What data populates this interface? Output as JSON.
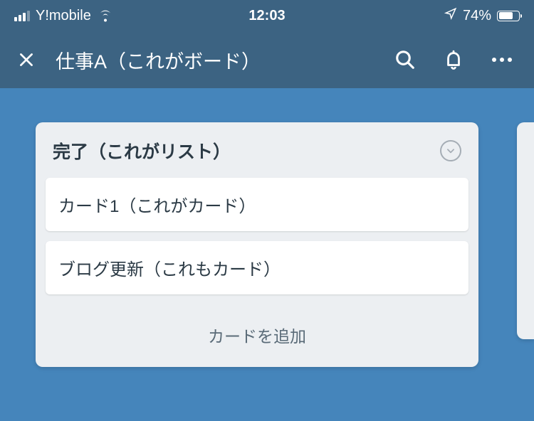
{
  "status": {
    "carrier": "Y!mobile",
    "time": "12:03",
    "battery_pct": "74%"
  },
  "header": {
    "board_title": "仕事A（これがボード）"
  },
  "list": {
    "title": "完了（これがリスト）",
    "cards": [
      {
        "title": "カード1（これがカード）"
      },
      {
        "title": "ブログ更新（これもカード）"
      }
    ],
    "add_card_label": "カードを追加"
  }
}
